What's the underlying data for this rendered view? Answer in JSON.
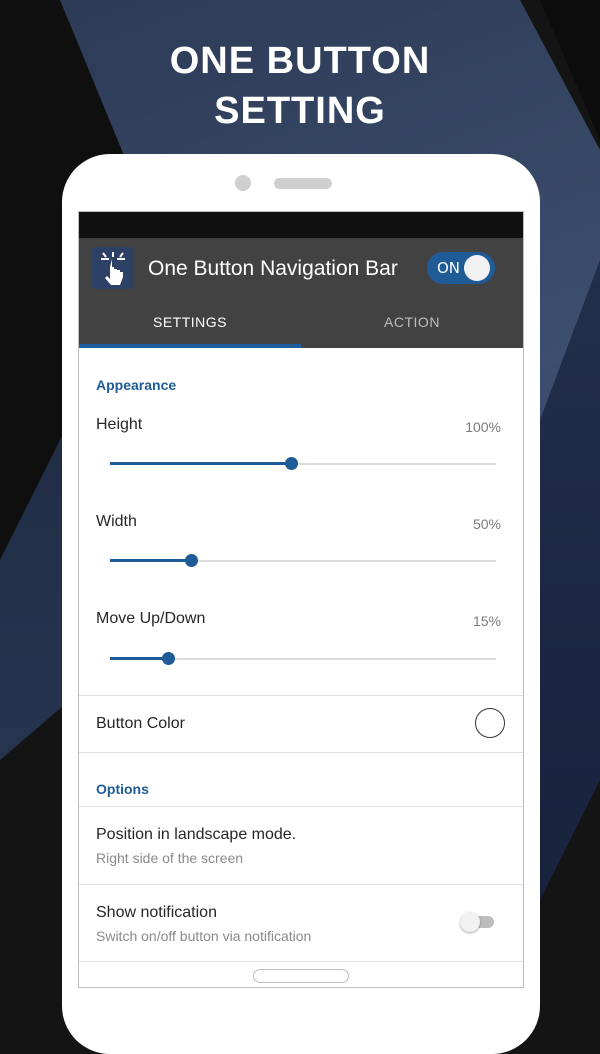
{
  "headline": {
    "line1": "ONE BUTTON",
    "line2": "SETTING"
  },
  "app": {
    "title": "One Button Navigation Bar",
    "toggle_label": "ON",
    "toggle_on": true,
    "icon": "tap-hand-icon"
  },
  "tabs": [
    {
      "label": "SETTINGS",
      "active": true
    },
    {
      "label": "ACTION",
      "active": false
    }
  ],
  "appearance": {
    "header": "Appearance",
    "height": {
      "label": "Height",
      "value_text": "100%",
      "slider_fraction": 0.47
    },
    "width": {
      "label": "Width",
      "value_text": "50%",
      "slider_fraction": 0.21
    },
    "move": {
      "label": "Move Up/Down",
      "value_text": "15%",
      "slider_fraction": 0.15
    }
  },
  "button_color": {
    "label": "Button Color",
    "swatch": "#ffffff"
  },
  "options": {
    "header": "Options",
    "landscape": {
      "title": "Position in landscape mode.",
      "subtitle": "Right side of the screen"
    },
    "notification": {
      "title": "Show notification",
      "subtitle": "Switch on/off button via notification",
      "enabled": false
    }
  },
  "colors": {
    "accent": "#1e5b97",
    "appbar": "#424242",
    "statusbar": "#111111"
  }
}
